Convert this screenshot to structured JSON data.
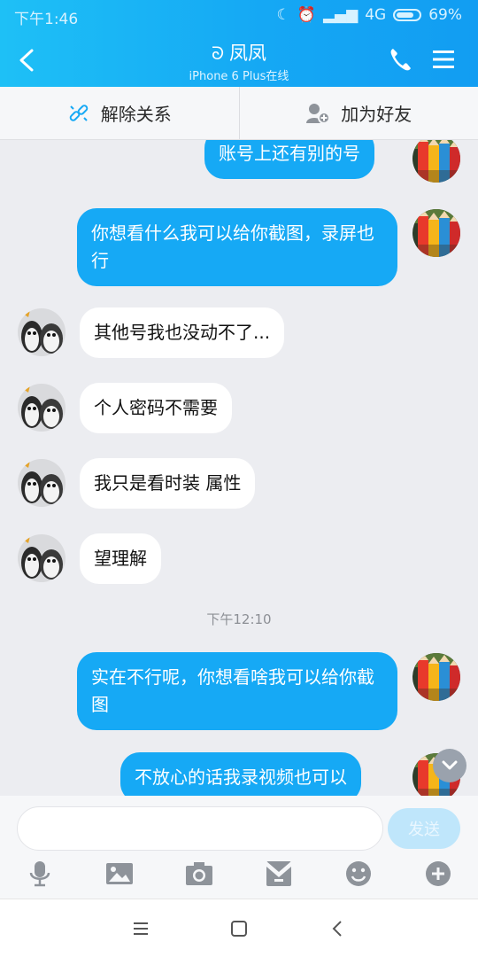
{
  "status": {
    "time": "下午1:46",
    "network": "4G",
    "battery": "69%"
  },
  "header": {
    "title": "凤凤",
    "subtitle": "iPhone 6 Plus在线"
  },
  "actions": {
    "remove": "解除关系",
    "add_friend": "加为好友"
  },
  "messages": [
    {
      "side": "out",
      "text": "账号上还有别的号"
    },
    {
      "side": "out",
      "text": "你想看什么我可以给你截图，录屏也行"
    },
    {
      "side": "in",
      "text": "其他号我也没动不了..."
    },
    {
      "side": "in",
      "text": "个人密码不需要"
    },
    {
      "side": "in",
      "text": "我只是看时装 属性"
    },
    {
      "side": "in",
      "text": "望理解"
    },
    {
      "side": "time",
      "text": "下午12:10"
    },
    {
      "side": "out",
      "text": "实在不行呢，你想看啥我可以给你截图"
    },
    {
      "side": "out",
      "text": "不放心的话我录视频也可以"
    }
  ],
  "input": {
    "placeholder": "",
    "send_label": "发送"
  },
  "tools": [
    "microphone-icon",
    "image-icon",
    "camera-icon",
    "folder-icon",
    "emoji-icon",
    "plus-icon"
  ],
  "colors": {
    "header_start": "#1ec0f6",
    "header_end": "#129df2",
    "bubble_out": "#16a9f5",
    "bubble_in": "#ffffff",
    "background": "#ecedf1"
  }
}
